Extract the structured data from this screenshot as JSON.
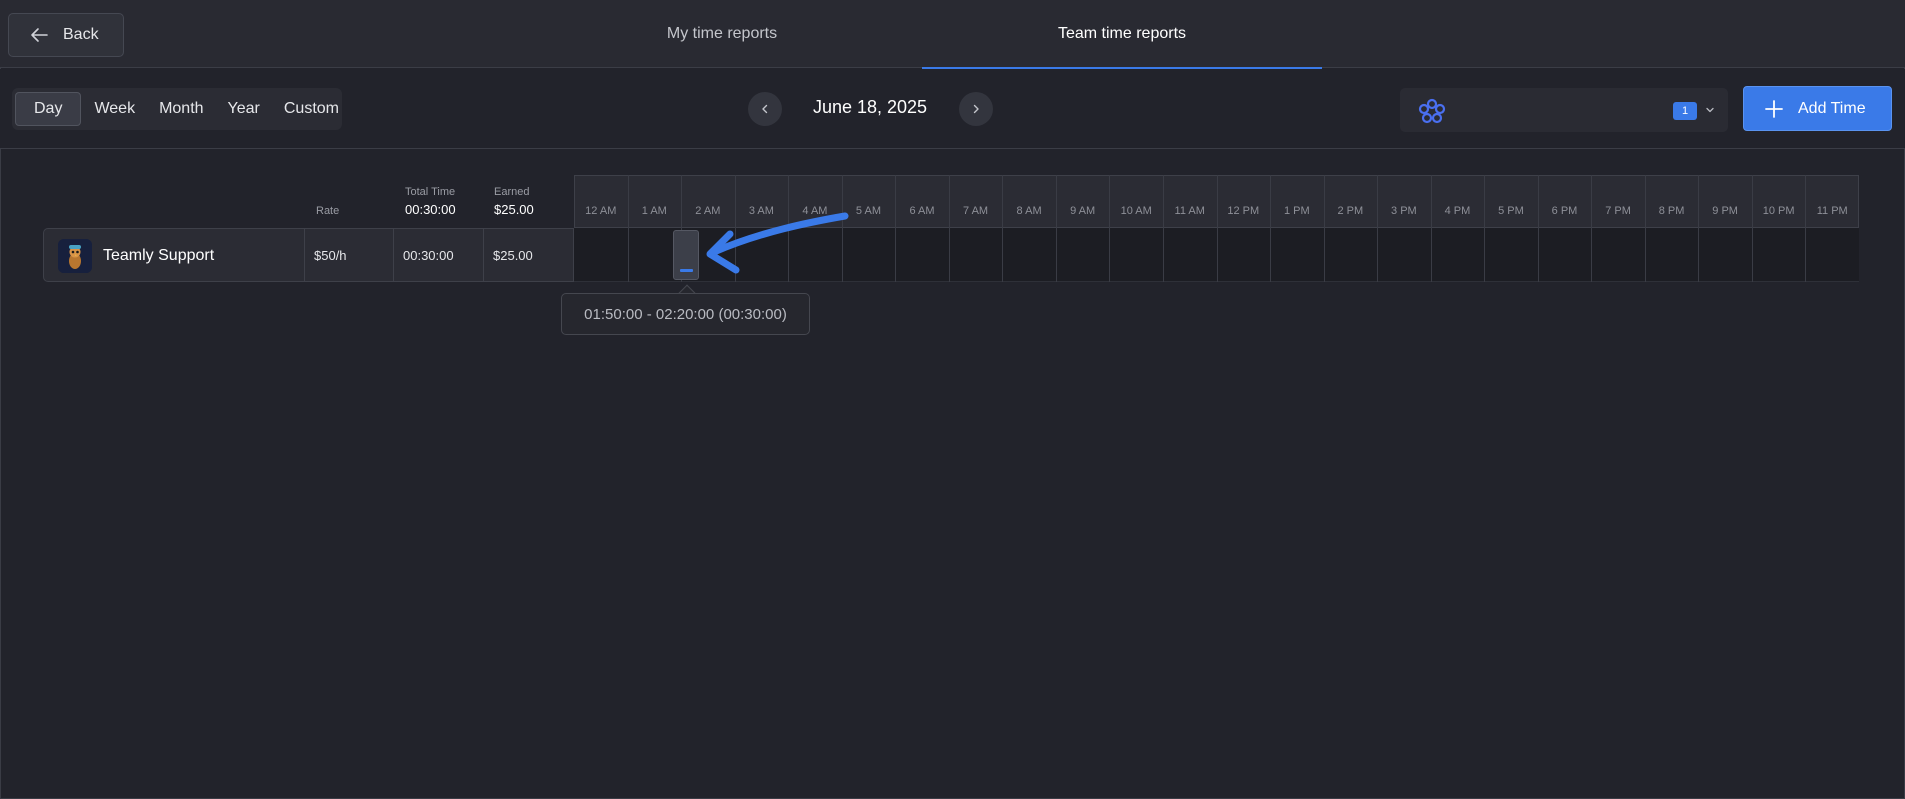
{
  "header": {
    "back_label": "Back",
    "tabs": [
      {
        "label": "My time reports",
        "active": false
      },
      {
        "label": "Team time reports",
        "active": true
      }
    ]
  },
  "toolbar": {
    "periods": [
      "Day",
      "Week",
      "Month",
      "Year",
      "Custom"
    ],
    "active_period": "Day",
    "date": "June 18, 2025",
    "team_count": "1",
    "add_time_label": "Add Time"
  },
  "table": {
    "headers": {
      "rate": "Rate",
      "total_time_label": "Total Time",
      "total_time_value": "00:30:00",
      "earned_label": "Earned",
      "earned_value": "$25.00"
    },
    "rows": [
      {
        "name": "Teamly Support",
        "rate": "$50/h",
        "total_time": "00:30:00",
        "earned": "$25.00"
      }
    ]
  },
  "timeline": {
    "hours": [
      "12 AM",
      "1 AM",
      "2 AM",
      "3 AM",
      "4 AM",
      "5 AM",
      "6 AM",
      "7 AM",
      "8 AM",
      "9 AM",
      "10 AM",
      "11 AM",
      "12 PM",
      "1 PM",
      "2 PM",
      "3 PM",
      "4 PM",
      "5 PM",
      "6 PM",
      "7 PM",
      "8 PM",
      "9 PM",
      "10 PM",
      "11 PM"
    ],
    "entry": {
      "start": "01:50:00",
      "end": "02:20:00",
      "duration": "00:30:00"
    },
    "tooltip": "01:50:00 - 02:20:00 (00:30:00)"
  },
  "colors": {
    "accent": "#3a7ae8",
    "background": "#22232b"
  },
  "icons": [
    "arrow-left-icon",
    "chevron-left-icon",
    "chevron-right-icon",
    "team-logo-icon",
    "chevron-down-icon",
    "plus-icon"
  ]
}
